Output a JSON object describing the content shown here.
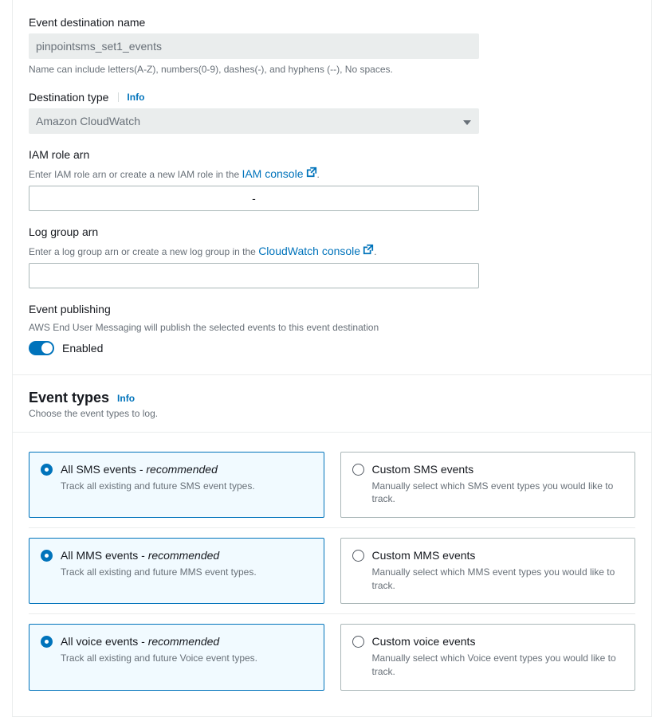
{
  "form": {
    "name": {
      "label": "Event destination name",
      "value": "pinpointsms_set1_events",
      "helper": "Name can include letters(A-Z), numbers(0-9), dashes(-), and hyphens (--), No spaces."
    },
    "destType": {
      "label": "Destination type",
      "infoLabel": "Info",
      "value": "Amazon CloudWatch"
    },
    "iamRole": {
      "label": "IAM role arn",
      "helperPrefix": "Enter IAM role arn or create a new IAM role in the ",
      "linkText": "IAM console",
      "helperSuffix": ".",
      "value": "-"
    },
    "logGroup": {
      "label": "Log group arn",
      "helperPrefix": "Enter a log group arn or create a new log group in the ",
      "linkText": "CloudWatch console",
      "helperSuffix": ".",
      "value": ""
    },
    "publishing": {
      "label": "Event publishing",
      "helper": "AWS End User Messaging will publish the selected events to this event destination",
      "toggleLabel": "Enabled",
      "enabled": true
    }
  },
  "eventTypes": {
    "title": "Event types",
    "infoLabel": "Info",
    "sub": "Choose the event types to log.",
    "recSuffix": "recommended",
    "rows": [
      {
        "all": {
          "title": "All SMS events - ",
          "desc": "Track all existing and future SMS event types."
        },
        "custom": {
          "title": "Custom SMS events",
          "desc": "Manually select which SMS event types you would like to track."
        }
      },
      {
        "all": {
          "title": "All MMS events - ",
          "desc": "Track all existing and future MMS event types."
        },
        "custom": {
          "title": "Custom MMS events",
          "desc": "Manually select which MMS event types you would like to track."
        }
      },
      {
        "all": {
          "title": "All voice events - ",
          "desc": "Track all existing and future Voice event types."
        },
        "custom": {
          "title": "Custom voice events",
          "desc": "Manually select which Voice event types you would like to track."
        }
      }
    ]
  }
}
